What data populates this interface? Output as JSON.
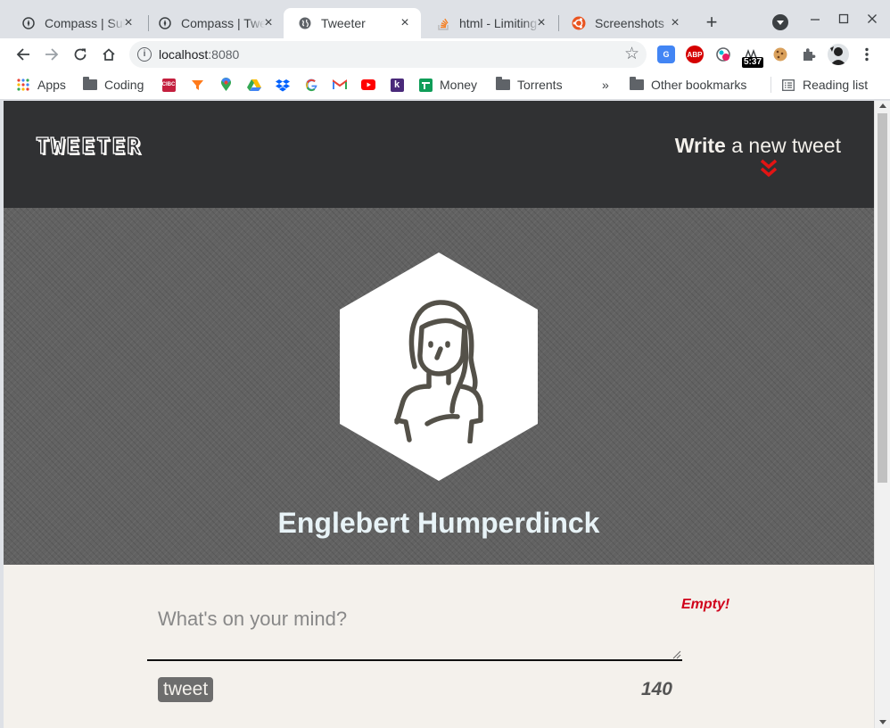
{
  "browser": {
    "tabs": [
      {
        "title": "Compass | Submit",
        "favicon": "compass-icon",
        "active": false
      },
      {
        "title": "Compass | Tweeter",
        "favicon": "compass-icon",
        "active": false
      },
      {
        "title": "Tweeter",
        "favicon": "globe-icon",
        "active": true
      },
      {
        "title": "html - Limiting",
        "favicon": "stackoverflow-icon",
        "active": false
      },
      {
        "title": "Screenshots",
        "favicon": "ubuntu-icon",
        "active": false
      }
    ],
    "url_host": "localhost",
    "url_port": ":8080",
    "extension_badge": "5:37",
    "bookmarks": {
      "apps": "Apps",
      "coding": "Coding",
      "money": "Money",
      "torrents": "Torrents",
      "more": "»",
      "other": "Other bookmarks",
      "reading_list": "Reading list"
    }
  },
  "page": {
    "logo": "TWEETER",
    "write_bold": "Write",
    "write_rest": " a new tweet",
    "user_name": "Englebert Humperdinck",
    "composer": {
      "placeholder": "What's on your mind?",
      "error": "Empty!",
      "button": "tweet",
      "counter": "140"
    },
    "colors": {
      "nav_bg": "#303133",
      "hero_bg": "#626262",
      "page_bg": "#f4f1ec",
      "accent_red": "#d0021b",
      "avatar_stroke": "#545149"
    }
  }
}
